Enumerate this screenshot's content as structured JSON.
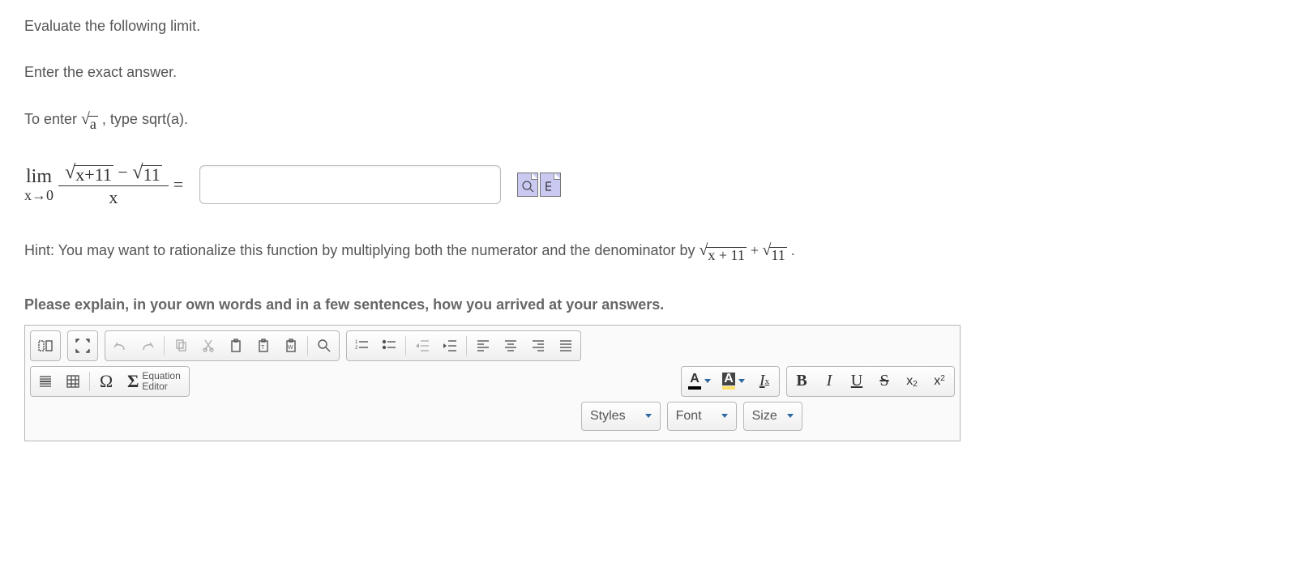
{
  "prompt": {
    "line1": "Evaluate the following limit.",
    "line2": "Enter the exact answer.",
    "line3_a": "To enter ",
    "line3_sqrt_radicand": "a",
    "line3_b": ", type sqrt(a)."
  },
  "limit": {
    "lim": "lim",
    "approach": "x→0",
    "num_sqrt1": "x+11",
    "num_minus": "−",
    "num_sqrt2": "11",
    "den": "x",
    "equals": "="
  },
  "answer": {
    "value": "",
    "placeholder": ""
  },
  "hint": {
    "pre": "Hint: You may want to rationalize this function by multiplying both the numerator and the denominator by ",
    "sqrt1": "x + 11",
    "plus": " + ",
    "sqrt2": "11",
    "post": "."
  },
  "explain_label": "Please explain, in your own words and in a few sentences, how you arrived at your answers.",
  "editor": {
    "equation_editor_label_top": "Equation",
    "equation_editor_label_bot": "Editor",
    "styles": "Styles",
    "font": "Font",
    "size": "Size",
    "A": "A",
    "B": "B",
    "I": "I",
    "U": "U",
    "S": "S",
    "x": "x",
    "two": "2",
    "omega": "Ω",
    "sigma": "Σ",
    "Ix": "I",
    "Ix_sub": "x"
  }
}
